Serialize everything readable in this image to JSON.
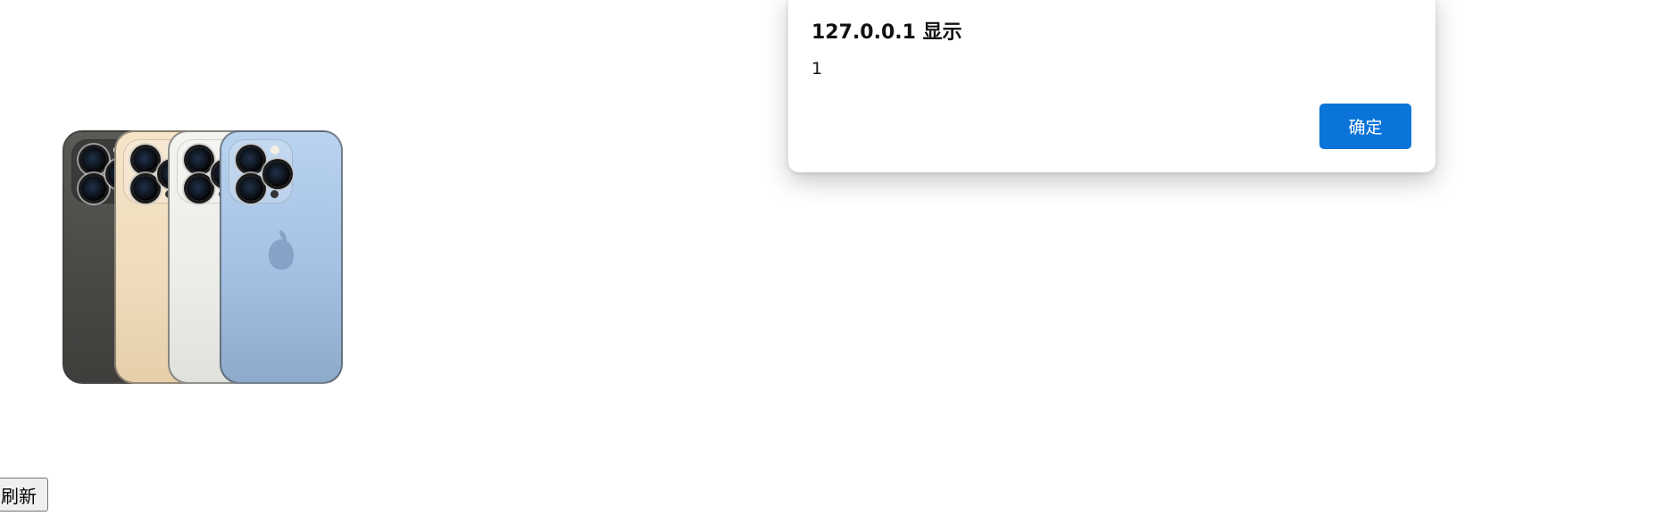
{
  "page": {
    "refresh_label": "刷新"
  },
  "dialog": {
    "title": "127.0.0.1 显示",
    "message": "1",
    "ok_label": "确定",
    "accent_color": "#0a74d8"
  },
  "image": {
    "phone_colors": [
      "#4f4e4b",
      "#efdcbc",
      "#ecece8",
      "#a4c1e4"
    ],
    "icon": "smartphone-icon"
  }
}
